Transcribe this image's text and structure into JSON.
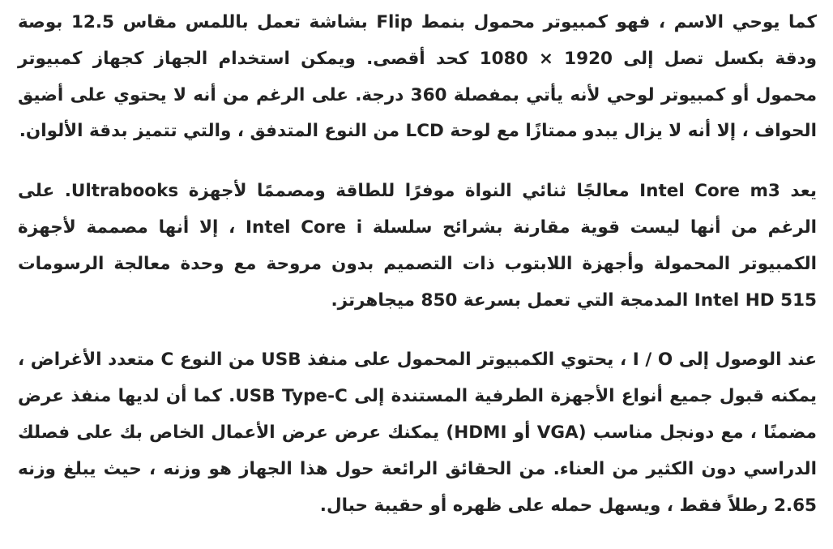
{
  "article": {
    "paragraphs": [
      "كما يوحي الاسم ، فهو كمبيوتر محمول بنمط Flip بشاشة تعمل باللمس مقاس 12.5 بوصة ودقة بكسل تصل إلى 1920 × 1080 كحد أقصى. ويمكن استخدام الجهاز كجهاز كمبيوتر محمول أو كمبيوتر لوحي لأنه يأتي بمفصلة 360 درجة. على الرغم من أنه لا يحتوي على أضيق الحواف ، إلا أنه لا يزال يبدو ممتازًا مع لوحة LCD من النوع المتدفق ، والتي تتميز بدقة الألوان.",
      "يعد Intel Core m3 معالجًا ثنائي النواة موفرًا للطاقة ومصممًا لأجهزة Ultrabooks. على الرغم من أنها ليست قوية مقارنة بشرائح سلسلة Intel Core i ، إلا أنها مصممة لأجهزة الكمبيوتر المحمولة وأجهزة اللابتوب ذات التصميم بدون مروحة مع وحدة معالجة الرسومات Intel HD 515 المدمجة التي تعمل بسرعة 850 ميجاهرتز.",
      "عند الوصول إلى I / O ، يحتوي الكمبيوتر المحمول على منفذ USB من النوع C متعدد الأغراض ، يمكنه قبول جميع أنواع الأجهزة الطرفية المستندة إلى USB Type-C. كما أن لديها منفذ عرض مضمنًا ، مع دونجل مناسب (VGA أو HDMI) يمكنك عرض عرض الأعمال الخاص بك على فصلك الدراسي دون الكثير من العناء. من الحقائق الرائعة حول هذا الجهاز هو وزنه ، حيث يبلغ وزنه 2.65 رطلاً فقط ، ويسهل حمله على ظهره أو حقيبة حبال."
    ]
  }
}
